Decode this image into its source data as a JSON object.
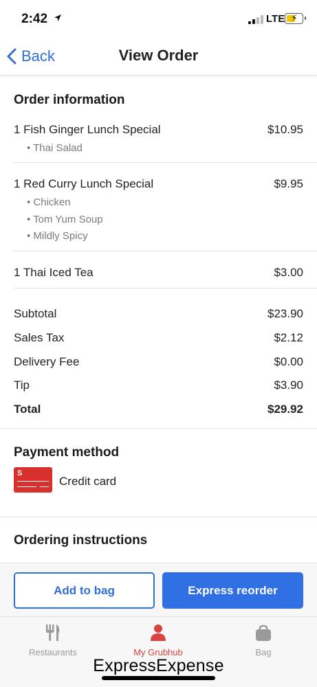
{
  "status_bar": {
    "time": "2:42",
    "network": "LTE"
  },
  "nav": {
    "back_label": "Back",
    "title": "View Order"
  },
  "order": {
    "section_title": "Order information",
    "items": [
      {
        "name": "1 Fish Ginger Lunch Special",
        "price": "$10.95",
        "options": [
          "• Thai Salad"
        ]
      },
      {
        "name": "1 Red Curry Lunch Special",
        "price": "$9.95",
        "options": [
          "• Chicken",
          "• Tom Yum Soup",
          "• Mildly Spicy"
        ]
      },
      {
        "name": "1 Thai Iced Tea",
        "price": "$3.00",
        "options": []
      }
    ],
    "totals": [
      {
        "label": "Subtotal",
        "value": "$23.90"
      },
      {
        "label": "Sales Tax",
        "value": "$2.12"
      },
      {
        "label": "Delivery Fee",
        "value": "$0.00"
      },
      {
        "label": "Tip",
        "value": "$3.90"
      },
      {
        "label": "Total",
        "value": "$29.92"
      }
    ]
  },
  "payment": {
    "section_title": "Payment method",
    "method": "Credit card",
    "card_letter": "S"
  },
  "instructions": {
    "section_title": "Ordering instructions"
  },
  "actions": {
    "add_to_bag": "Add to bag",
    "express_reorder": "Express reorder"
  },
  "tabs": [
    {
      "label": "Restaurants",
      "icon": "utensils-icon",
      "active": false
    },
    {
      "label": "My Grubhub",
      "icon": "person-icon",
      "active": true
    },
    {
      "label": "Bag",
      "icon": "bag-icon",
      "active": false
    }
  ],
  "watermark": "ExpressExpense",
  "colors": {
    "accent": "#2f6fd6",
    "primary_button": "#2f6ee3",
    "brand_red": "#d6453f",
    "card_red": "#d6312d"
  }
}
